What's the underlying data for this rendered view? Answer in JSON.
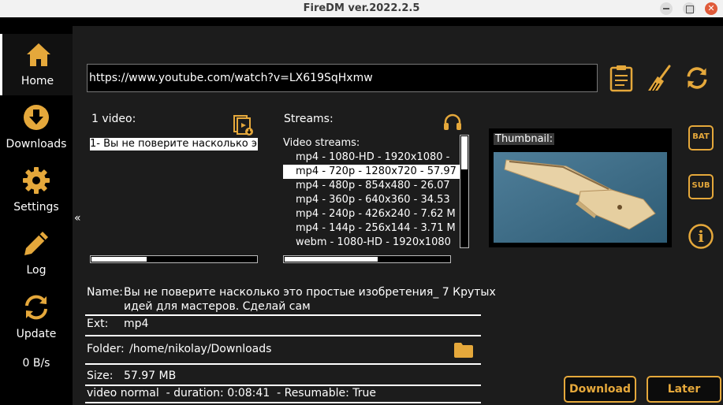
{
  "window": {
    "title": "FireDM ver.2022.2.5",
    "close_glyph": "✕"
  },
  "colors": {
    "accent": "#e5a83b",
    "background": "#1c1c1c",
    "sidebar": "#000000"
  },
  "sidebar": {
    "items": [
      {
        "label": "Home",
        "icon": "home-icon"
      },
      {
        "label": "Downloads",
        "icon": "download-icon"
      },
      {
        "label": "Settings",
        "icon": "gear-icon"
      },
      {
        "label": "Log",
        "icon": "pencil-icon"
      },
      {
        "label": "Update",
        "icon": "refresh-icon"
      }
    ],
    "speed": "0 B/s"
  },
  "url": {
    "value": "https://www.youtube.com/watch?v=LX619SqHxmw"
  },
  "playlist": {
    "label": "1 video:",
    "items": [
      "1- Вы не поверите насколько э"
    ]
  },
  "streams": {
    "label": "Streams:",
    "header": "Video streams:",
    "rows": [
      "mp4 - 1080-HD - 1920x1080 -",
      "mp4 - 720p - 1280x720 - 57.97",
      "mp4 - 480p - 854x480 - 26.07",
      "mp4 - 360p - 640x360 - 34.53",
      "mp4 - 240p - 426x240 - 7.62 M",
      "mp4 - 144p - 256x144 - 3.71 M",
      "webm - 1080-HD - 1920x1080"
    ]
  },
  "thumbnail": {
    "label": "Thumbnail:"
  },
  "side_buttons": {
    "bat": "BAT",
    "sub": "SUB",
    "info": "i"
  },
  "collapse_glyph": "«",
  "info": {
    "name_label": "Name:",
    "name_line1": "Вы не поверите насколько это простые изобретения_ 7 Крутых",
    "name_line2": "идей для мастеров. Сделай сам",
    "ext_label": "Ext:",
    "ext_value": "mp4",
    "folder_label": "Folder:",
    "folder_value": "/home/nikolay/Downloads",
    "size_label": "Size:",
    "size_value": "57.97 MB",
    "summary": "video normal  - duration: 0:08:41  - Resumable: True"
  },
  "actions": {
    "download": "Download",
    "later": "Later"
  }
}
